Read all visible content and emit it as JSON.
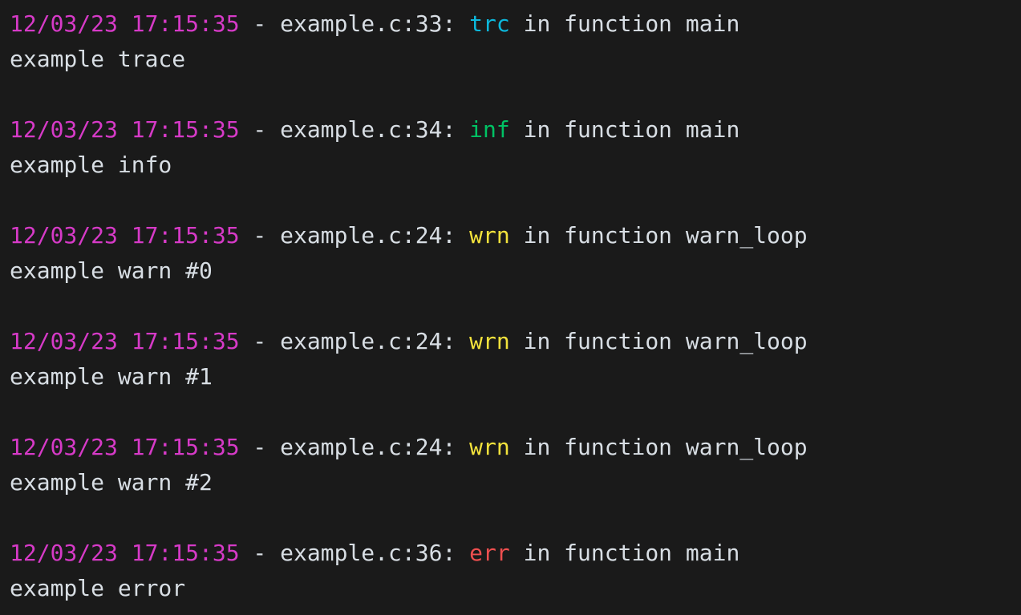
{
  "terminal": {
    "background_color": "#1a1a1a",
    "default_text_color": "#d8dee4",
    "timestamp_color": "#d63ac7",
    "separator": " - ",
    "level_colors": {
      "trc": "#0cb8dc",
      "inf": "#00c264",
      "wrn": "#f2e23c",
      "err": "#ef4f4f"
    },
    "entries": [
      {
        "timestamp": "12/03/23 17:15:35",
        "separator": " - ",
        "location": "example.c:33: ",
        "level": "trc",
        "level_color": "#0cb8dc",
        "context": " in function main",
        "message": "example trace"
      },
      {
        "timestamp": "12/03/23 17:15:35",
        "separator": " - ",
        "location": "example.c:34: ",
        "level": "inf",
        "level_color": "#00c264",
        "context": " in function main",
        "message": "example info"
      },
      {
        "timestamp": "12/03/23 17:15:35",
        "separator": " - ",
        "location": "example.c:24: ",
        "level": "wrn",
        "level_color": "#f2e23c",
        "context": " in function warn_loop",
        "message": "example warn #0"
      },
      {
        "timestamp": "12/03/23 17:15:35",
        "separator": " - ",
        "location": "example.c:24: ",
        "level": "wrn",
        "level_color": "#f2e23c",
        "context": " in function warn_loop",
        "message": "example warn #1"
      },
      {
        "timestamp": "12/03/23 17:15:35",
        "separator": " - ",
        "location": "example.c:24: ",
        "level": "wrn",
        "level_color": "#f2e23c",
        "context": " in function warn_loop",
        "message": "example warn #2"
      },
      {
        "timestamp": "12/03/23 17:15:35",
        "separator": " - ",
        "location": "example.c:36: ",
        "level": "err",
        "level_color": "#ef4f4f",
        "context": " in function main",
        "message": "example error"
      }
    ]
  }
}
